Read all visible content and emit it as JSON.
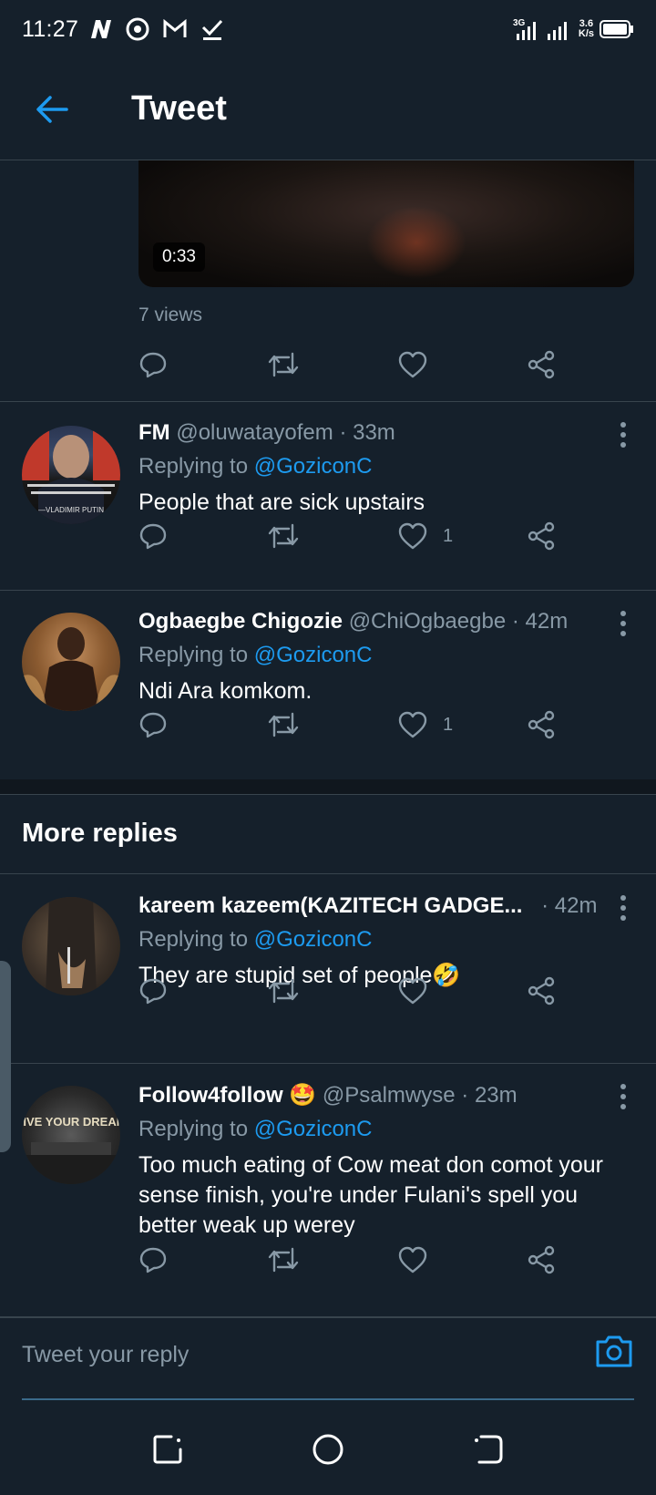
{
  "status": {
    "time": "11:27",
    "network": "3G",
    "speed_value": "3.6",
    "speed_unit": "K/s"
  },
  "header": {
    "title": "Tweet"
  },
  "video": {
    "duration": "0:33",
    "views": "7 views"
  },
  "replies": [
    {
      "name": "FM",
      "handle": "@oluwatayofem",
      "time": "· 33m",
      "replying_prefix": "Replying to",
      "replying_to": "@GoziconC",
      "text": "People that are sick upstairs",
      "likes": "1",
      "avatar_caption": "—VLADIMIR PUTIN"
    },
    {
      "name": "Ogbaegbe Chigozie",
      "handle": "@ChiOgbaegbe",
      "time": "· 42m",
      "replying_prefix": "Replying to",
      "replying_to": "@GoziconC",
      "text": "Ndi Ara komkom.",
      "likes": "1"
    }
  ],
  "more_replies": {
    "title": "More replies",
    "items": [
      {
        "name": "kareem kazeem(KAZITECH GADGE...",
        "handle": "",
        "time": "· 42m",
        "replying_prefix": "Replying to",
        "replying_to": "@GoziconC",
        "text": "They are stupid set of people🤣",
        "likes": ""
      },
      {
        "name": "Follow4follow 🤩",
        "handle": "@Psalmwyse",
        "time": "· 23m",
        "replying_prefix": "Replying to",
        "replying_to": "@GoziconC",
        "text": "Too much eating of Cow meat don comot your sense finish, you're under Fulani's spell you better weak up werey",
        "likes": "",
        "avatar_caption": "LIVE YOUR DREAM"
      }
    ]
  },
  "compose": {
    "placeholder": "Tweet your reply"
  },
  "colors": {
    "background": "#15202b",
    "accent": "#1d9bf0",
    "muted": "#8899a6",
    "border": "#38444d"
  },
  "icons": [
    "back-arrow-icon",
    "reply-icon",
    "retweet-icon",
    "like-icon",
    "share-icon",
    "more-options-icon",
    "camera-icon",
    "recents-icon",
    "home-icon",
    "back-nav-icon"
  ]
}
